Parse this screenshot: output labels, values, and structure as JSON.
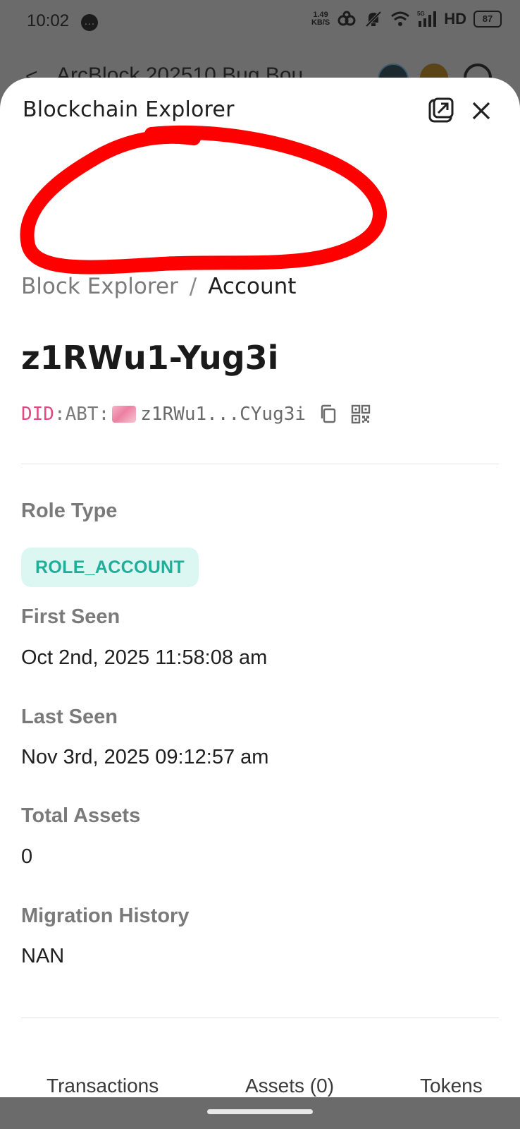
{
  "status_bar": {
    "time": "10:02",
    "net_speed_value": "1.49",
    "net_speed_unit": "KB/S",
    "network_label": "HD",
    "signal_label": "5G",
    "battery": "87"
  },
  "behind_header": {
    "title": "ArcBlock 202510 Bug Bou"
  },
  "sheet": {
    "title": "Blockchain Explorer"
  },
  "breadcrumb": {
    "parent": "Block Explorer",
    "separator": "/",
    "current": "Account"
  },
  "account": {
    "title": "z1RWu1-Yug3i",
    "did_prefix": "DID",
    "did_colon": ":",
    "did_abt": "ABT:",
    "did_short": "z1RWu1...CYug3i"
  },
  "fields": {
    "role_type_label": "Role Type",
    "role_type_value": "ROLE_ACCOUNT",
    "first_seen_label": "First Seen",
    "first_seen_value": "Oct 2nd, 2025 11:58:08 am",
    "last_seen_label": "Last Seen",
    "last_seen_value": "Nov 3rd, 2025 09:12:57 am",
    "total_assets_label": "Total Assets",
    "total_assets_value": "0",
    "migration_label": "Migration History",
    "migration_value": "NAN"
  },
  "tabs": {
    "transactions": "Transactions",
    "assets": "Assets (0)",
    "tokens": "Tokens"
  },
  "colors": {
    "annotation_red": "#ff0000",
    "role_chip_bg": "#dcf6f2",
    "role_chip_text": "#1fae9a",
    "did_prefix": "#e04a82"
  }
}
